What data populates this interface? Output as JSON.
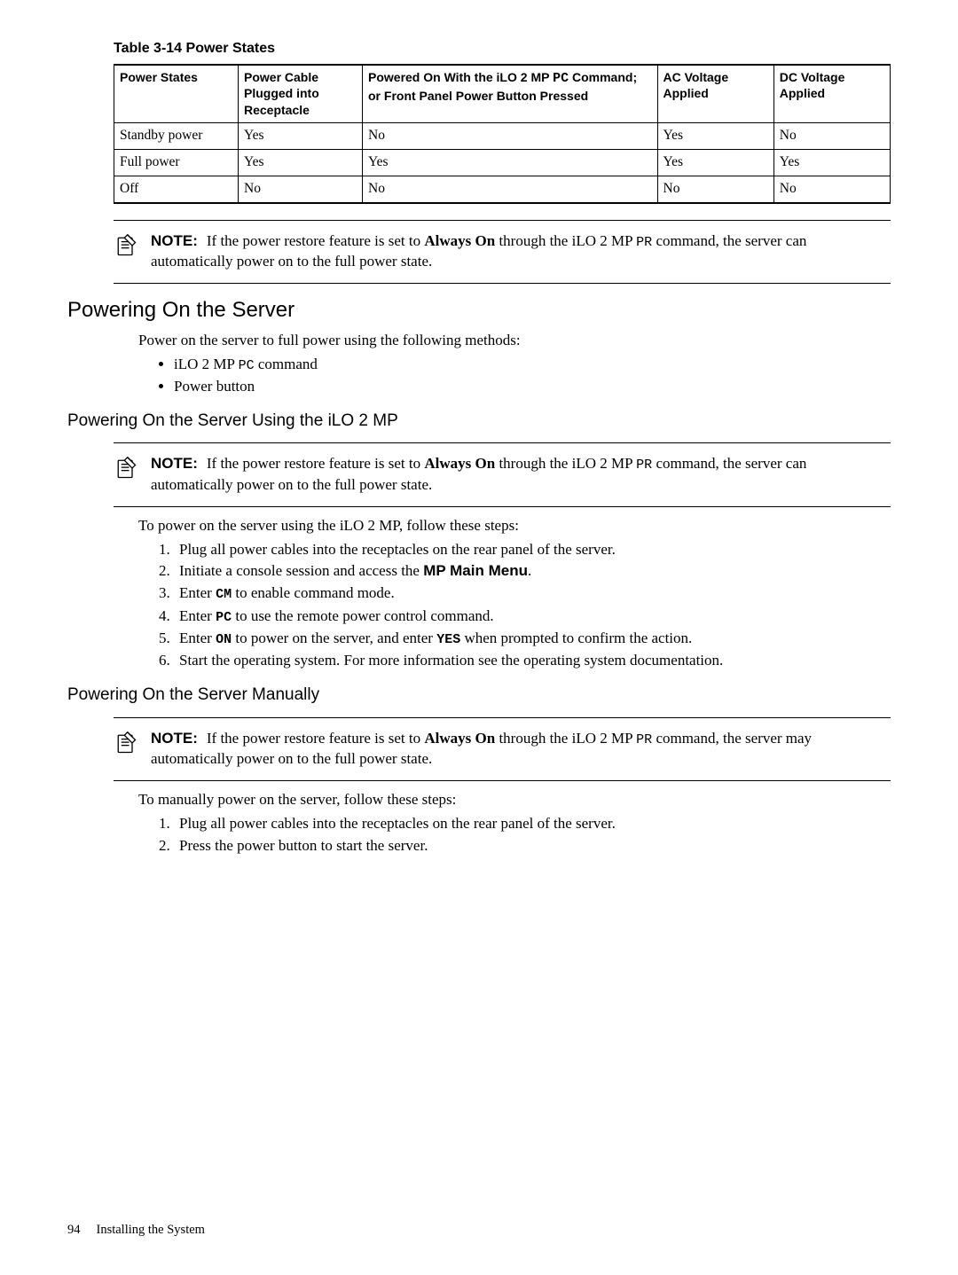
{
  "table": {
    "title": "Table 3-14 Power States",
    "headers": [
      "Power States",
      "Power Cable Plugged into Receptacle",
      "Powered On With the iLO 2 MP PC Command; or Front Panel Power Button Pressed",
      "AC Voltage Applied",
      "DC Voltage Applied"
    ],
    "rows": [
      [
        "Standby power",
        "Yes",
        "No",
        "Yes",
        "No"
      ],
      [
        "Full power",
        "Yes",
        "Yes",
        "Yes",
        "Yes"
      ],
      [
        "Off",
        "No",
        "No",
        "No",
        "No"
      ]
    ]
  },
  "notes": {
    "label": "NOTE:",
    "n1a": "If the power restore feature is set to ",
    "n1b": "Always On",
    "n1c": " through the iLO 2 MP ",
    "n1d": "PR",
    "n1e": " command, the server can automatically power on to the full power state.",
    "n3e": " command, the server may automatically power on to the full power state."
  },
  "h2": "Powering On the Server",
  "intro": "Power on the server to full power using the following methods:",
  "bullets": {
    "b1a": "iLO 2 MP ",
    "b1b": "PC",
    "b1c": " command",
    "b2": "Power button"
  },
  "h3a": "Powering On the Server Using the iLO 2 MP",
  "p_ilo": "To power on the server using the iLO 2 MP, follow these steps:",
  "steps_ilo": {
    "s1": "Plug all power cables into the receptacles on the rear panel of the server.",
    "s2a": "Initiate a console session and access the ",
    "s2b": "MP Main Menu",
    "s2c": ".",
    "s3a": "Enter ",
    "s3b": "CM",
    "s3c": " to enable command mode.",
    "s4a": "Enter ",
    "s4b": "PC",
    "s4c": " to use the remote power control command.",
    "s5a": "Enter ",
    "s5b": "ON",
    "s5c": " to power on the server, and enter ",
    "s5d": "YES",
    "s5e": " when prompted to confirm the action.",
    "s6": "Start the operating system. For more information see the operating system documentation."
  },
  "h3b": "Powering On the Server Manually",
  "p_man": "To manually power on the server, follow these steps:",
  "steps_man": {
    "s1": "Plug all power cables into the receptacles on the rear panel of the server.",
    "s2": "Press the power button to start the server."
  },
  "footer": {
    "page": "94",
    "chapter": "Installing the System"
  }
}
